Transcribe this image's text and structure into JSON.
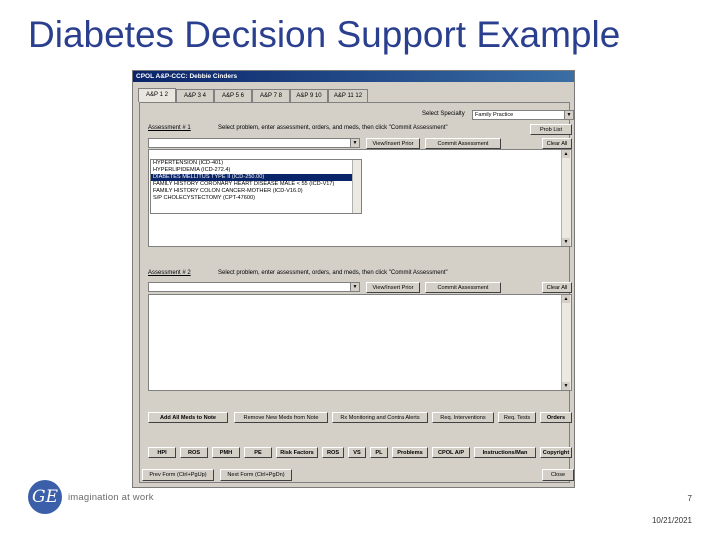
{
  "slide": {
    "title": "Diabetes Decision Support Example",
    "footer_tagline": "imagination at work",
    "page_number": "7",
    "date": "10/21/2021",
    "logo_text": "GE"
  },
  "window": {
    "title": "CPOL A&P-CCC: Debbie Cinders"
  },
  "tabs": [
    {
      "label": "A&P 1 2"
    },
    {
      "label": "A&P 3 4"
    },
    {
      "label": "A&P 5 6"
    },
    {
      "label": "A&P 7 8"
    },
    {
      "label": "A&P 9 10"
    },
    {
      "label": "A&P 11 12"
    }
  ],
  "specialty": {
    "label": "Select Specialty",
    "value": "Family Practice"
  },
  "section1": {
    "label": "Assessment # 1",
    "instruction": "Select problem, enter assessment, orders, and meds, then click \"Commit Assessment\"",
    "problem_list_button": "Prob List",
    "view_insert_prior": "View/Insert Prior",
    "commit": "Commit Assessment",
    "clear_all": "Clear All",
    "problems": [
      "HYPERTENSION (ICD-401)",
      "HYPERLIPIDEMIA (ICD-272.4)",
      "DIABETES MELLITUS TYPE II (ICD-250.00)",
      "FAMILY HISTORY CORONARY HEART DISEASE MALE < 55 (ICD-V17)",
      "FAMILY HISTORY COLON CANCER-MOTHER (ICD-V16.0)",
      "S/P CHOLECYSTECTOMY (CPT-47600)"
    ]
  },
  "section2": {
    "label": "Assessment # 2",
    "instruction": "Select problem, enter assessment, orders, and meds, then click \"Commit Assessment\"",
    "view_insert_prior": "View/Insert Prior",
    "commit": "Commit Assessment",
    "clear_all": "Clear All"
  },
  "action_buttons": {
    "add_meds": "Add All Meds to Note",
    "remove_meds": "Remove New Meds from Note",
    "rx_monitoring": "Rx Monitoring and Contra Alerts",
    "req_interventions": "Req. Interventions",
    "req_tests": "Req. Tests",
    "orders": "Orders"
  },
  "nav_buttons": [
    "HPI",
    "ROS",
    "PMH",
    "PE",
    "Risk Factors",
    "ROS",
    "VS",
    "PL",
    "Problems",
    "CPOL A/P",
    "Instructions/Man",
    "Copyright"
  ],
  "bottom": {
    "prev_form": "Prev Form (Ctrl+PgUp)",
    "next_form": "Next Form (Ctrl+PgDn)",
    "close": "Close"
  }
}
